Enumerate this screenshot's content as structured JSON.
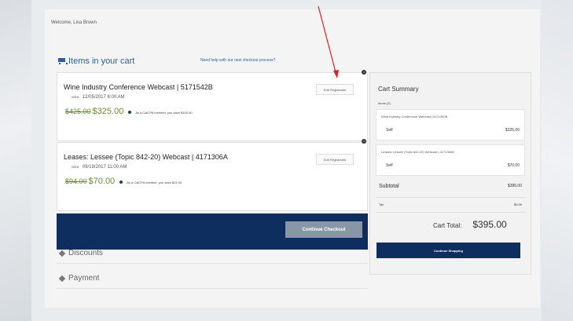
{
  "header": {
    "welcome": "Welcome, Lisa Brown"
  },
  "cart": {
    "title": "Items in your cart",
    "help_link": "Need help with our new checkout process?",
    "items": [
      {
        "title": "Wine Industry Conference Webcast | 5171542B",
        "date_label": "WEB",
        "date": "12/05/2017 8:00 AM",
        "old_price": "$425.00",
        "price": "$325.00",
        "member_note": "As a CalCPA member, you save $100.00",
        "edit_label": "Edit Registrants"
      },
      {
        "title": "Leases: Lessee (Topic 842-20) Webcast | 4171306A",
        "date_label": "WEB",
        "date": "09/19/2017 11:00 AM",
        "old_price": "$94.00",
        "price": "$70.00",
        "member_note": "As a CalCPA member, you save $24.00",
        "edit_label": "Edit Registrants"
      }
    ],
    "checkout_label": "Continue Checkout",
    "accordion": [
      "Discounts",
      "Payment"
    ]
  },
  "summary": {
    "title": "Cart Summary",
    "items_label": "Items (2)",
    "items": [
      {
        "name": "Wine Industry Conference Webcast | 5171542B",
        "who": "Self",
        "amount": "$325.00"
      },
      {
        "name": "Leases: Lessee (Topic 842-20) Webcast | 4171306A",
        "who": "Self",
        "amount": "$70.00"
      }
    ],
    "subtotal_label": "Subtotal",
    "subtotal": "$395.00",
    "tax_label": "Tax",
    "tax": "$0.00",
    "total_label": "Cart Total:",
    "total": "$395.00",
    "continue_label": "Continue Shopping"
  },
  "colors": {
    "navy": "#0d2e5e",
    "link": "#2b5f9e",
    "price": "#6a8a3a",
    "annotation_arrow": "#e02020"
  }
}
